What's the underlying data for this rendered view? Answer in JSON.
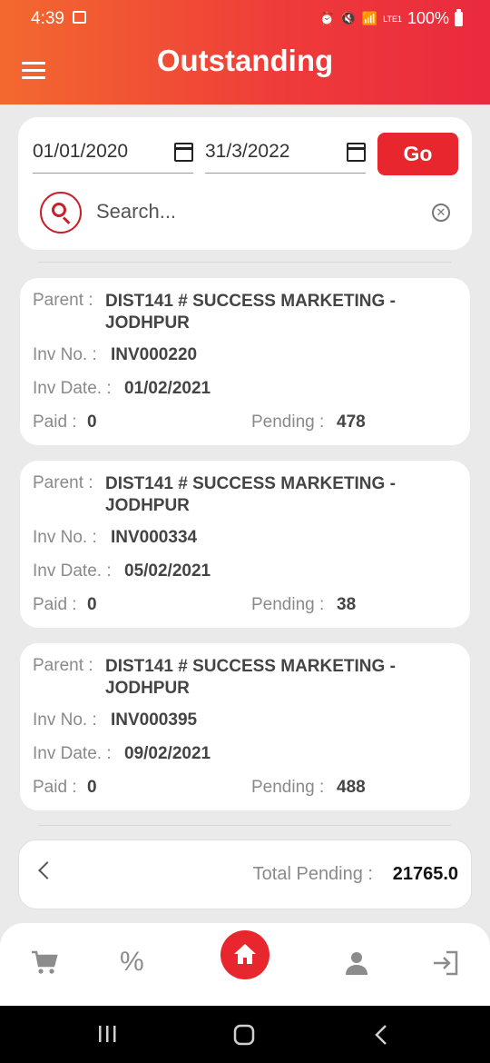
{
  "status_bar": {
    "time": "4:39",
    "battery": "100%",
    "network": "LTE1"
  },
  "header": {
    "title": "Outstanding"
  },
  "filters": {
    "from_date": "01/01/2020",
    "to_date": "31/3/2022",
    "go_label": "Go",
    "search_placeholder": "Search..."
  },
  "labels": {
    "parent": "Parent :",
    "inv_no": "Inv No. :",
    "inv_date": "Inv Date. :",
    "paid": "Paid :",
    "pending": "Pending :"
  },
  "invoices": [
    {
      "parent": "DIST141 # SUCCESS MARKETING - JODHPUR",
      "inv_no": "INV000220",
      "inv_date": "01/02/2021",
      "paid": "0",
      "pending": "478"
    },
    {
      "parent": "DIST141 # SUCCESS MARKETING - JODHPUR",
      "inv_no": "INV000334",
      "inv_date": "05/02/2021",
      "paid": "0",
      "pending": "38"
    },
    {
      "parent": "DIST141 # SUCCESS MARKETING - JODHPUR",
      "inv_no": "INV000395",
      "inv_date": "09/02/2021",
      "paid": "0",
      "pending": "488"
    }
  ],
  "footer": {
    "total_label": "Total Pending :",
    "total_value": "21765.0"
  },
  "bottom_nav": {
    "icons": [
      "cart-icon",
      "percent-icon",
      "home-icon",
      "person-icon",
      "logout-icon"
    ],
    "percent_glyph": "%"
  },
  "colors": {
    "accent": "#e8262d",
    "header_start": "#f3692f",
    "header_end": "#ea2a3e"
  }
}
